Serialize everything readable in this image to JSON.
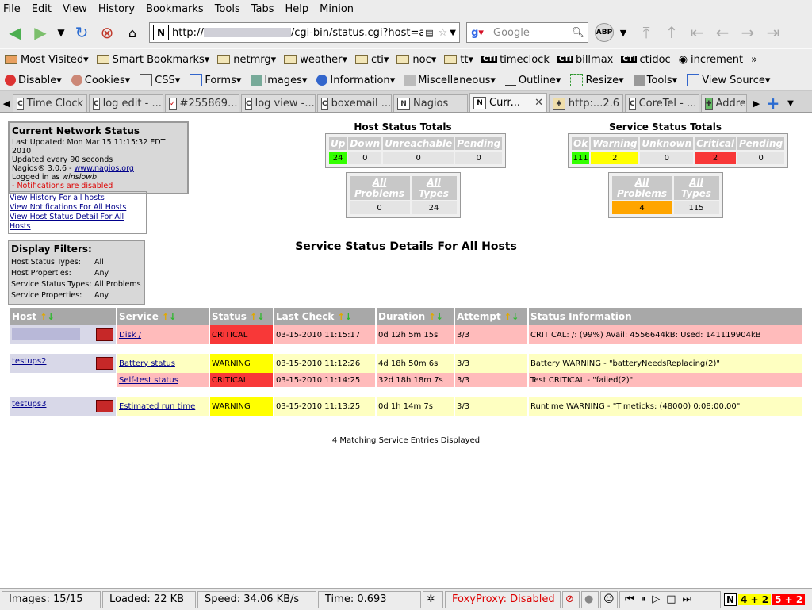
{
  "menu": [
    "File",
    "Edit",
    "View",
    "History",
    "Bookmarks",
    "Tools",
    "Tabs",
    "Help",
    "Minion"
  ],
  "url": {
    "prefix": "http://",
    "suffix": "/cgi-bin/status.cgi?host=all&s"
  },
  "search": {
    "placeholder": "Google"
  },
  "abp": "ABP",
  "bookmarks": [
    "Most Visited",
    "Smart Bookmarks",
    "netmrg",
    "weather",
    "cti",
    "noc",
    "tt",
    "timeclock",
    "billmax",
    "ctidoc",
    "increment"
  ],
  "webdev": [
    "Disable",
    "Cookies",
    "CSS",
    "Forms",
    "Images",
    "Information",
    "Miscellaneous",
    "Outline",
    "Resize",
    "Tools",
    "View Source"
  ],
  "tabs": [
    "Time Clock",
    "log edit - ...",
    "#255869...",
    "log view -...",
    "boxemail ...",
    "Nagios",
    "Curr...",
    "http:...2.6",
    "CoreTel - ...",
    "Addre"
  ],
  "network": {
    "title": "Current Network Status",
    "updated": "Last Updated: Mon Mar 15 11:15:32 EDT 2010",
    "every": "Updated every 90 seconds",
    "version": "Nagios® 3.0.6 - ",
    "site": "www.nagios.org",
    "logged_prefix": "Logged in as ",
    "user": "winslowb",
    "notif": "- Notifications are disabled"
  },
  "links": [
    "View History For all hosts",
    "View Notifications For All Hosts",
    "View Host Status Detail For All Hosts"
  ],
  "host_totals": {
    "title": "Host Status Totals",
    "headers": [
      "Up",
      "Down",
      "Unreachable",
      "Pending"
    ],
    "values": [
      "24",
      "0",
      "0",
      "0"
    ],
    "sub_headers": [
      "All Problems",
      "All Types"
    ],
    "sub_values": [
      "0",
      "24"
    ]
  },
  "service_totals": {
    "title": "Service Status Totals",
    "headers": [
      "Ok",
      "Warning",
      "Unknown",
      "Critical",
      "Pending"
    ],
    "values": [
      "111",
      "2",
      "0",
      "2",
      "0"
    ],
    "sub_headers": [
      "All Problems",
      "All Types"
    ],
    "sub_values": [
      "4",
      "115"
    ]
  },
  "filters": {
    "title": "Display Filters:",
    "rows": [
      [
        "Host Status Types:",
        "All"
      ],
      [
        "Host Properties:",
        "Any"
      ],
      [
        "Service Status Types:",
        "All Problems"
      ],
      [
        "Service Properties:",
        "Any"
      ]
    ]
  },
  "page_title": "Service Status Details For All Hosts",
  "columns": [
    "Host",
    "Service",
    "Status",
    "Last Check",
    "Duration",
    "Attempt",
    "Status Information"
  ],
  "rows": [
    {
      "host": "",
      "service": "Disk /",
      "status": "CRITICAL",
      "last": "03-15-2010 11:15:17",
      "duration": "0d 12h 5m 15s",
      "attempt": "3/3",
      "info": "CRITICAL: /: (99%) Avail: 4556644kB: Used: 141119904kB"
    },
    {
      "host": "testups2",
      "service": "Battery status",
      "status": "WARNING",
      "last": "03-15-2010 11:12:26",
      "duration": "4d 18h 50m 6s",
      "attempt": "3/3",
      "info": "Battery WARNING - \"batteryNeedsReplacing(2)\""
    },
    {
      "host": "",
      "service": "Self-test status",
      "status": "CRITICAL",
      "last": "03-15-2010 11:14:25",
      "duration": "32d 18h 18m 7s",
      "attempt": "3/3",
      "info": "Test CRITICAL - \"failed(2)\""
    },
    {
      "host": "testups3",
      "service": "Estimated run time",
      "status": "WARNING",
      "last": "03-15-2010 11:13:25",
      "duration": "0d 1h 14m 7s",
      "attempt": "3/3",
      "info": "Runtime WARNING - \"Timeticks: (48000) 0:08:00.00\""
    }
  ],
  "matching": "4 Matching Service Entries Displayed",
  "statusbar": {
    "images": "Images: 15/15",
    "loaded": "Loaded: 22 KB",
    "speed": "Speed: 34.06 KB/s",
    "time": "Time: 0.693",
    "proxy": "FoxyProxy: Disabled",
    "badge1": "4 + 2",
    "badge2": "5 + 2"
  }
}
